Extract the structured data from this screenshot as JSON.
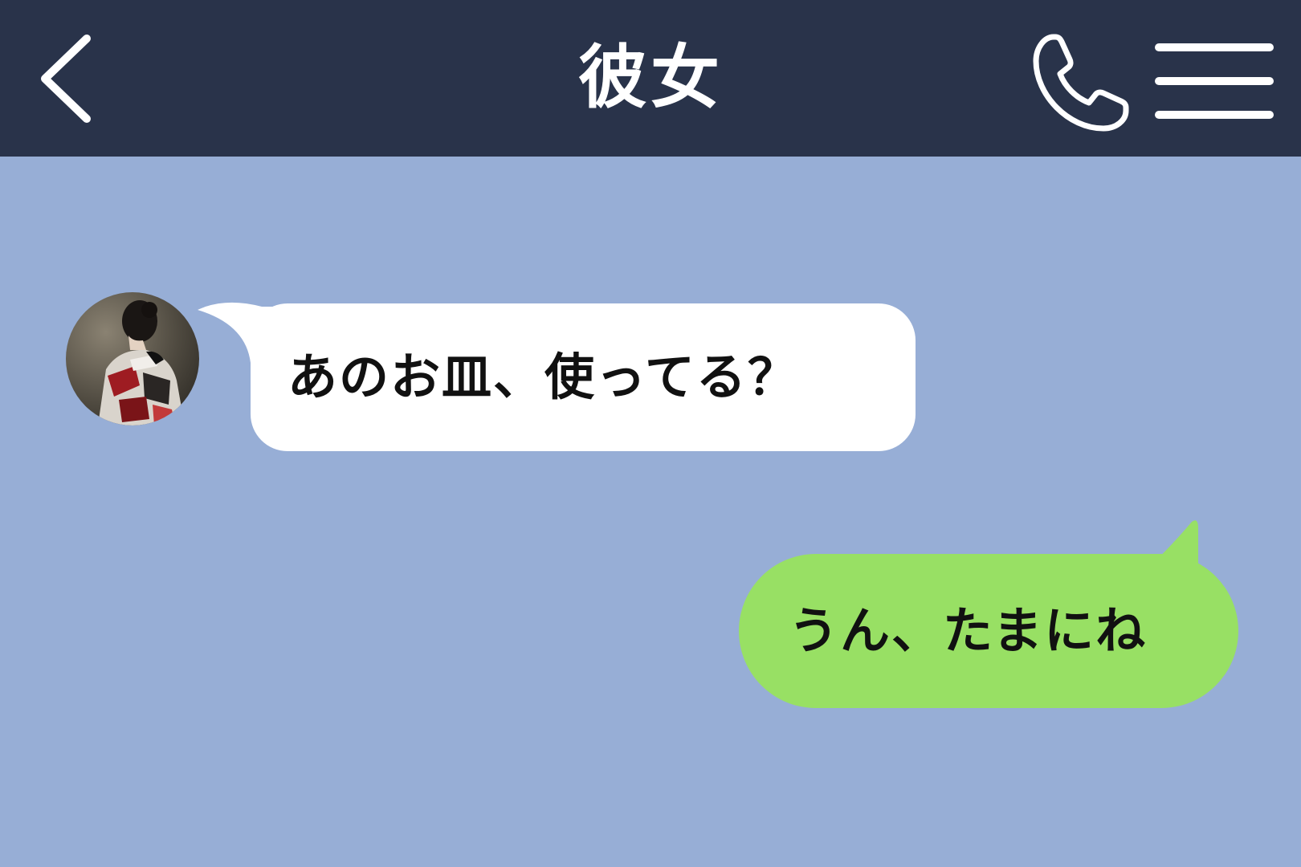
{
  "header": {
    "title": "彼女",
    "background": "#29334a",
    "icons": {
      "back": "chevron-left-icon",
      "call": "phone-icon",
      "menu": "hamburger-menu-icon"
    }
  },
  "chat": {
    "background": "#97aed6",
    "messages": [
      {
        "direction": "incoming",
        "text": "あのお皿、使ってる？",
        "bubble_color": "#ffffff",
        "has_avatar": true
      },
      {
        "direction": "outgoing",
        "text": "うん、たまにね",
        "bubble_color": "#98e064"
      }
    ]
  }
}
